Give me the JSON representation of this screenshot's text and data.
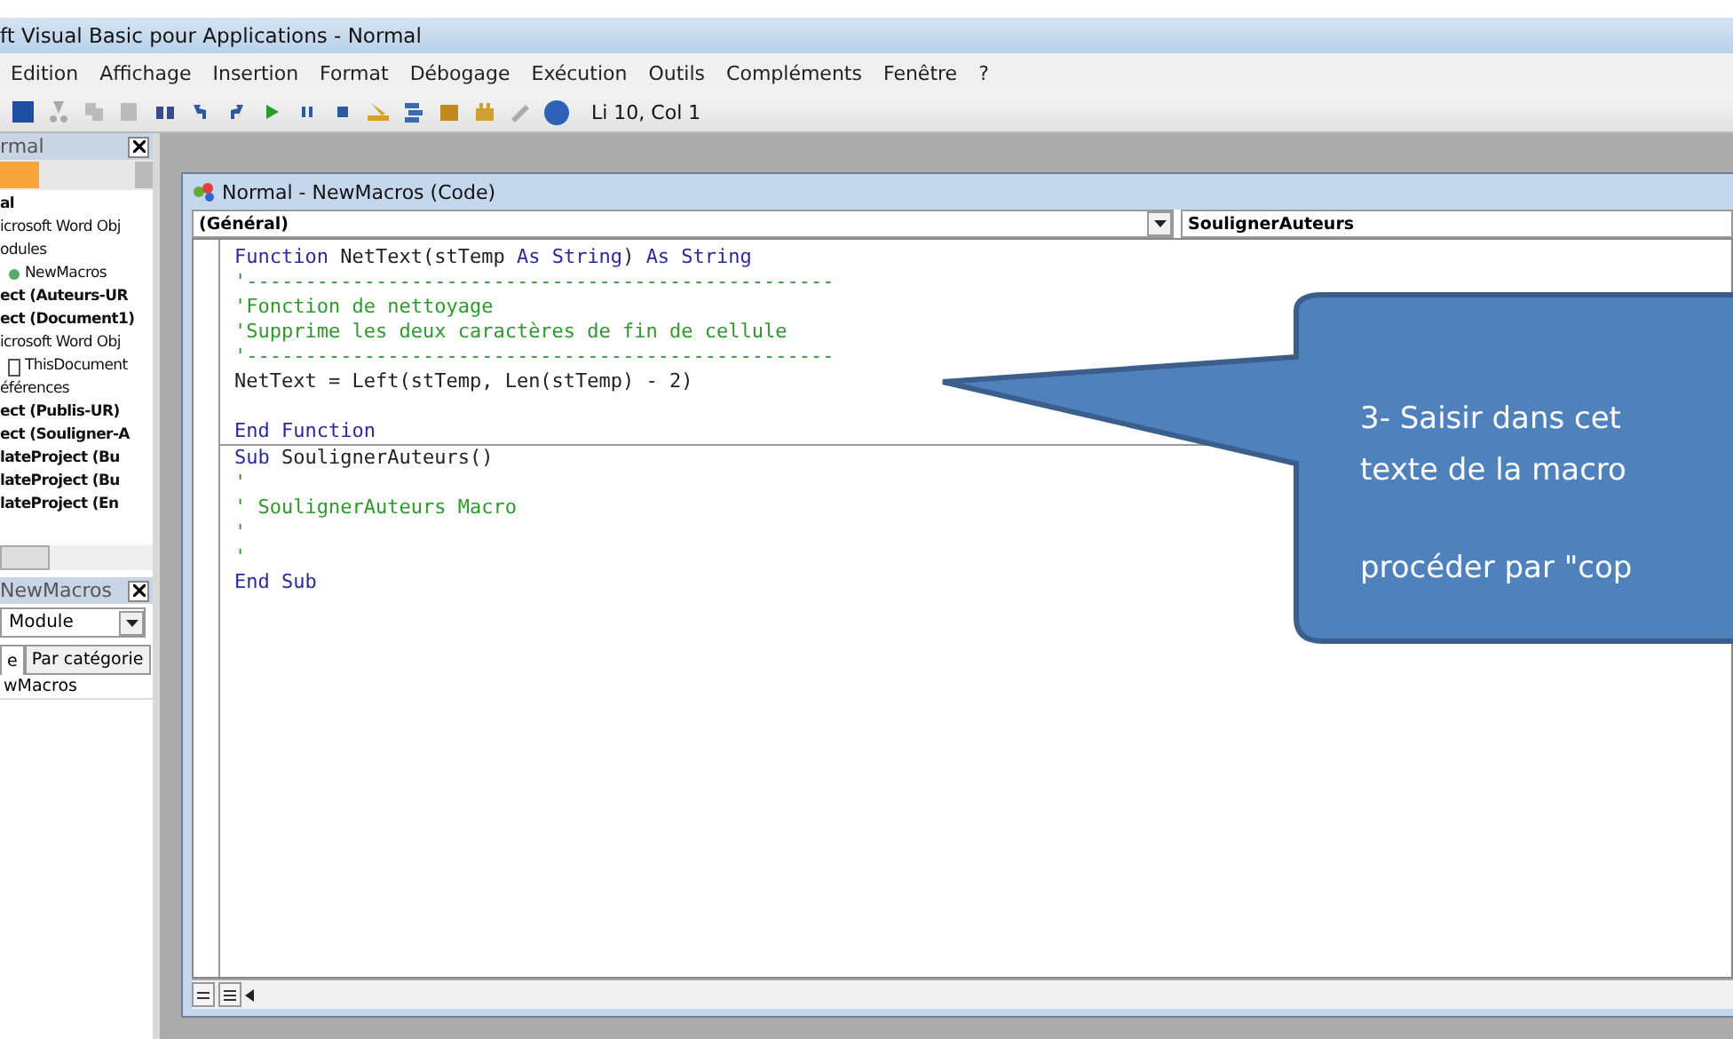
{
  "window": {
    "title": "ft Visual Basic pour Applications - Normal"
  },
  "menu": [
    "Edition",
    "Affichage",
    "Insertion",
    "Format",
    "Débogage",
    "Exécution",
    "Outils",
    "Compléments",
    "Fenêtre",
    "?"
  ],
  "toolbar": {
    "position": "Li 10, Col 1"
  },
  "project_explorer": {
    "title": "rmal",
    "items": [
      {
        "label": "al",
        "bold": true
      },
      {
        "label": "icrosoft Word Obj",
        "bold": false
      },
      {
        "label": "odules",
        "bold": false,
        "children": [
          {
            "label": "NewMacros",
            "bold": false,
            "kind": "module"
          }
        ]
      },
      {
        "label": "ect (Auteurs-UR",
        "bold": true
      },
      {
        "label": "ect (Document1)",
        "bold": true
      },
      {
        "label": "icrosoft Word Obj",
        "bold": false,
        "children": [
          {
            "label": "ThisDocument",
            "bold": false,
            "kind": "document"
          }
        ]
      },
      {
        "label": "éférences",
        "bold": false
      },
      {
        "label": "ect (Publis-UR)",
        "bold": true
      },
      {
        "label": "ect (Souligner-A",
        "bold": true
      },
      {
        "label": "lateProject (Bu",
        "bold": true
      },
      {
        "label": "lateProject (Bu",
        "bold": true
      },
      {
        "label": "lateProject (En",
        "bold": true
      }
    ]
  },
  "properties": {
    "title": "NewMacros",
    "object": "Module",
    "tabs": [
      {
        "label": "e",
        "selected": true
      },
      {
        "label": "Par catégorie",
        "selected": false
      }
    ],
    "rows": [
      "wMacros"
    ]
  },
  "code_window": {
    "title": "Normal - NewMacros (Code)",
    "object_combo": "(Général)",
    "procedure_combo": "SoulignerAuteurs",
    "procedures": [
      {
        "lines": [
          [
            {
              "text": "Function ",
              "kind": "keyword"
            },
            {
              "text": "NetText(stTemp ",
              "kind": "plain"
            },
            {
              "text": "As String",
              "kind": "keyword"
            },
            {
              "text": ") ",
              "kind": "plain"
            },
            {
              "text": "As String",
              "kind": "keyword"
            }
          ],
          [
            {
              "text": "'--------------------------------------------------",
              "kind": "comment"
            }
          ],
          [
            {
              "text": "'Fonction de nettoyage",
              "kind": "comment"
            }
          ],
          [
            {
              "text": "'Supprime les deux caractères de fin de cellule",
              "kind": "comment"
            }
          ],
          [
            {
              "text": "'--------------------------------------------------",
              "kind": "comment"
            }
          ],
          [
            {
              "text": "NetText = Left(stTemp, Len(stTemp) - 2)",
              "kind": "plain"
            }
          ],
          {
            "kind": "blank"
          },
          [
            {
              "text": "End Function",
              "kind": "keyword"
            }
          ]
        ]
      },
      {
        "lines": [
          [
            {
              "text": "Sub ",
              "kind": "keyword"
            },
            {
              "text": "SoulignerAuteurs()",
              "kind": "plain"
            }
          ],
          [
            {
              "text": "'",
              "kind": "comment"
            }
          ],
          [
            {
              "text": "' SoulignerAuteurs Macro",
              "kind": "comment"
            }
          ],
          [
            {
              "text": "'",
              "kind": "comment"
            }
          ],
          [
            {
              "text": "'",
              "kind": "comment"
            }
          ],
          [
            {
              "text": "End Sub",
              "kind": "keyword"
            }
          ]
        ]
      }
    ]
  },
  "callout": {
    "paragraphs": [
      [
        "3- Saisir dans cet",
        "texte de la macro"
      ],
      [
        "procéder par \"cop"
      ]
    ]
  }
}
